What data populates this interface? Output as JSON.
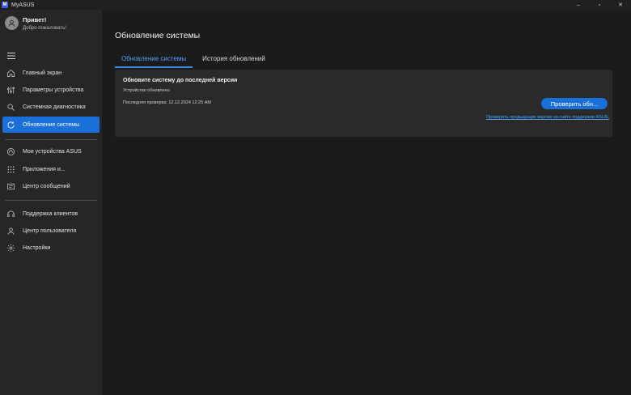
{
  "window": {
    "app_title": "MyASUS",
    "logo_text": "M",
    "controls": {
      "minimize": "–",
      "maximize": "▫",
      "close": "✕"
    }
  },
  "sidebar": {
    "user": {
      "greeting": "Привет!",
      "welcome": "Добро пожаловать!"
    },
    "items": [
      {
        "label": "Главный экран",
        "icon": "home-icon"
      },
      {
        "label": "Параметры устройства",
        "icon": "sliders-icon"
      },
      {
        "label": "Системная диагностика",
        "icon": "diagnostics-icon"
      },
      {
        "label": "Обновление системы",
        "icon": "update-icon",
        "active": true
      },
      {
        "label": "Мои устройства ASUS",
        "icon": "devices-icon"
      },
      {
        "label": "Приложения и...",
        "icon": "apps-grid-icon"
      },
      {
        "label": "Центр сообщений",
        "icon": "message-icon"
      },
      {
        "label": "Поддержка клиентов",
        "icon": "headset-icon"
      },
      {
        "label": "Центр пользователя",
        "icon": "user-icon"
      },
      {
        "label": "Настройки",
        "icon": "gear-icon"
      }
    ]
  },
  "main": {
    "title": "Обновление системы",
    "tabs": [
      {
        "label": "Обновление системы",
        "active": true
      },
      {
        "label": "История обновлений",
        "active": false
      }
    ],
    "card": {
      "title": "Обновите систему до последней версии",
      "status": "Устройство обновлено",
      "last_check": "Последняя проверка: 12.12.2024  12:25 AM",
      "button": "Проверить обн...",
      "link": "Проверить предыдущие версии на сайте поддержки ASUS."
    }
  },
  "colors": {
    "accent": "#1a6fd8",
    "link": "#4aa3ff",
    "sidebar": "#262626",
    "main": "#1b1b1b",
    "card": "#2a2a2a"
  }
}
